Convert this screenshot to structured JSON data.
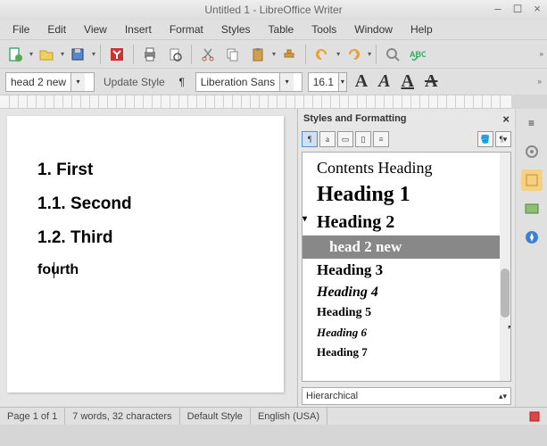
{
  "window": {
    "title": "Untitled 1 - LibreOffice Writer"
  },
  "menu": [
    "File",
    "Edit",
    "View",
    "Insert",
    "Format",
    "Styles",
    "Table",
    "Tools",
    "Window",
    "Help"
  ],
  "toolbar2": {
    "style_name": "head 2 new",
    "update_label": "Update Style",
    "font_name": "Liberation Sans",
    "font_size": "16.1"
  },
  "document": {
    "lines": [
      {
        "text": "1. First"
      },
      {
        "text": "1.1. Second"
      },
      {
        "text": "1.2. Third"
      },
      {
        "text": "fourth"
      }
    ]
  },
  "sidepanel": {
    "title": "Styles and Formatting",
    "styles": [
      {
        "label": "Contents Heading",
        "cls": "style-contents",
        "selected": false
      },
      {
        "label": "Heading 1",
        "cls": "style-h1",
        "selected": false
      },
      {
        "label": "Heading 2",
        "cls": "style-h2",
        "selected": false
      },
      {
        "label": "head 2 new",
        "cls": "style-h2new",
        "selected": true
      },
      {
        "label": "Heading 3",
        "cls": "style-h3",
        "selected": false
      },
      {
        "label": "Heading 4",
        "cls": "style-h4",
        "selected": false
      },
      {
        "label": "Heading 5",
        "cls": "style-h5",
        "selected": false
      },
      {
        "label": "Heading 6",
        "cls": "style-h6",
        "selected": false
      },
      {
        "label": "Heading 7",
        "cls": "style-h7",
        "selected": false
      }
    ],
    "filter": "Hierarchical"
  },
  "statusbar": {
    "page": "Page 1 of 1",
    "words": "7 words, 32 characters",
    "style": "Default Style",
    "lang": "English (USA)"
  }
}
